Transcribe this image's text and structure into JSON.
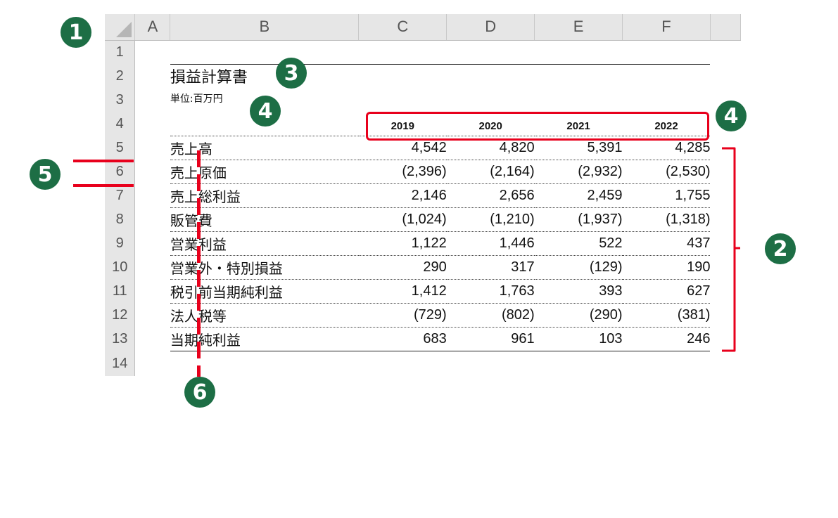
{
  "columns": [
    "A",
    "B",
    "C",
    "D",
    "E",
    "F"
  ],
  "rows": [
    "1",
    "2",
    "3",
    "4",
    "5",
    "6",
    "7",
    "8",
    "9",
    "10",
    "11",
    "12",
    "13",
    "14"
  ],
  "sheet": {
    "title": "損益計算書",
    "unit": "単位:百万円",
    "years": [
      "2019",
      "2020",
      "2021",
      "2022"
    ],
    "lines": [
      {
        "label": "売上高",
        "values": [
          "4,542",
          "4,820",
          "5,391",
          "4,285"
        ]
      },
      {
        "label": "売上原価",
        "values": [
          "(2,396)",
          "(2,164)",
          "(2,932)",
          "(2,530)"
        ]
      },
      {
        "label": "売上総利益",
        "values": [
          "2,146",
          "2,656",
          "2,459",
          "1,755"
        ]
      },
      {
        "label": "販管費",
        "values": [
          "(1,024)",
          "(1,210)",
          "(1,937)",
          "(1,318)"
        ]
      },
      {
        "label": "営業利益",
        "values": [
          "1,122",
          "1,446",
          "522",
          "437"
        ]
      },
      {
        "label": "営業外・特別損益",
        "values": [
          "290",
          "317",
          "(129)",
          "190"
        ]
      },
      {
        "label": "税引前当期純利益",
        "values": [
          "1,412",
          "1,763",
          "393",
          "627"
        ]
      },
      {
        "label": "法人税等",
        "values": [
          "(729)",
          "(802)",
          "(290)",
          "(381)"
        ]
      },
      {
        "label": "当期純利益",
        "values": [
          "683",
          "961",
          "103",
          "246"
        ]
      }
    ]
  },
  "annotations": {
    "b1": "1",
    "b2": "2",
    "b3": "3",
    "b4a": "4",
    "b4b": "4",
    "b5": "5",
    "b6": "6"
  },
  "colors": {
    "badge": "#1d6e45",
    "annotation_red": "#e8001c",
    "header_bg": "#e6e6e6"
  }
}
